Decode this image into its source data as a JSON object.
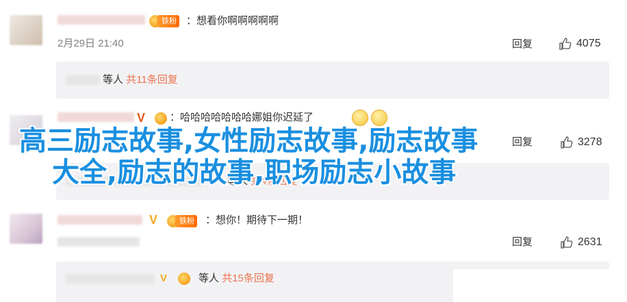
{
  "comments": [
    {
      "text": "：想看你啊啊啊啊啊",
      "fan_badge": "铁粉",
      "time": "2月29日 21:40",
      "reply_label": "回复",
      "likes": "4075",
      "replies_prefix": "等人",
      "replies_count": "共11条回复"
    },
    {
      "text": "：哈哈哈哈哈哈哈娜姐你迟延了",
      "time_hidden": "",
      "reply_label": "回复",
      "likes": "3278",
      "replies_prefix": "等人",
      "replies_count": "共4条回复"
    },
    {
      "text": "：想你！期待下一期！",
      "fan_badge": "铁粉",
      "reply_label": "回复",
      "likes": "2631",
      "replies_prefix": "等人",
      "replies_count": "共15条回复"
    }
  ],
  "overlay": {
    "line1": "高三励志故事,女性励志故事,励志故事",
    "line2": "大全,励志的故事,职场励志小故事"
  },
  "colors": {
    "accent": "#eb7350",
    "overlay_text": "#1a8fe0",
    "reply_bg": "#f2f2f5"
  },
  "icons": [
    "vip-v-icon",
    "fan-level-icon",
    "thumbs-up-icon",
    "laugh-emoji-icon"
  ]
}
